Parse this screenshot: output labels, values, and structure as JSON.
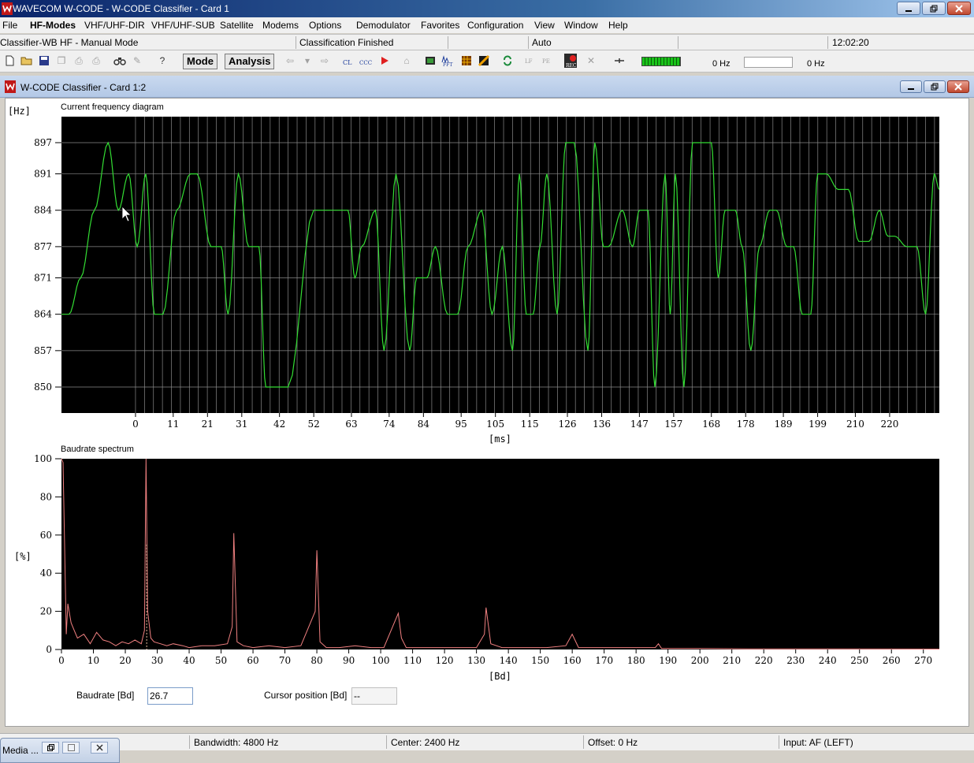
{
  "app": {
    "title": "WAVECOM W-CODE - W-CODE Classifier  - Card 1"
  },
  "menu": [
    "File",
    "HF-Modes",
    "VHF/UHF-DIR",
    "VHF/UHF-SUB",
    "Satellite",
    "Modems",
    "Options",
    "Demodulator",
    "Favorites",
    "Configuration",
    "View",
    "Window",
    "Help"
  ],
  "status_top": {
    "mode": "Classifier-WB HF - Manual Mode",
    "state": "Classification Finished",
    "auto": "Auto",
    "time": "12:02:20"
  },
  "toolbar": {
    "mode_label": "Mode",
    "analysis_label": "Analysis",
    "freq_left": "0 Hz",
    "freq_right": "0 Hz"
  },
  "child_window": {
    "title": "W-CODE Classifier  - Card 1:2"
  },
  "frequency_panel": {
    "title": "Current frequency diagram",
    "y_unit": "[Hz]",
    "x_unit": "[ms]"
  },
  "baud_panel": {
    "title": "Baudrate spectrum",
    "y_unit": "[%]",
    "x_unit": "[Bd]"
  },
  "fields": {
    "baudrate_label": "Baudrate [Bd]",
    "baudrate_value": "26.7",
    "cursor_label": "Cursor position [Bd]",
    "cursor_value": "--"
  },
  "status_bottom": {
    "bandwidth": "Bandwidth: 4800 Hz",
    "center": "Center: 2400 Hz",
    "offset": "Offset: 0 Hz",
    "input": "Input: AF (LEFT)"
  },
  "taskbar": {
    "media_title": "Media ..."
  },
  "colors": {
    "freq_trace": "#33dd33",
    "baud_trace": "#f08080",
    "plot_bg": "#000000",
    "grid": "#8a8a8a"
  },
  "chart_data": [
    {
      "type": "line",
      "title": "Current frequency diagram",
      "ylabel": "[Hz]",
      "xlabel": "[ms]",
      "y_ticks": [
        897,
        891,
        884,
        877,
        871,
        864,
        857,
        850
      ],
      "x_ticks": [
        0,
        11,
        21,
        31,
        42,
        52,
        63,
        74,
        84,
        95,
        105,
        115,
        126,
        136,
        147,
        157,
        168,
        178,
        189,
        199,
        210,
        220
      ],
      "ylim": [
        845,
        902
      ],
      "xlim": [
        -21.6,
        234.5
      ],
      "grid": true,
      "x": [
        -21.6,
        -19.4,
        -16.0,
        -12.0,
        -8.0,
        -5.0,
        -2.0,
        0.5,
        3.0,
        5.5,
        8.0,
        12.0,
        16.0,
        18.0,
        22.0,
        25.0,
        27.0,
        30.0,
        33.0,
        36.0,
        38.0,
        42.0,
        44.5,
        52.0,
        54.5,
        62.0,
        64.0,
        66.0,
        70.0,
        72.5,
        76.0,
        80.0,
        82.0,
        85.0,
        87.5,
        91.0,
        94.0,
        97.0,
        101.0,
        104.0,
        107.0,
        110.0,
        112.0,
        114.0,
        116.0,
        118.0,
        120.0,
        123.0,
        125.5,
        128.0,
        132.0,
        134.0,
        136.5,
        138.0,
        142.0,
        145.0,
        147.0,
        149.5,
        151.5,
        154.5,
        156.0,
        157.5,
        160.0,
        162.5,
        165.0,
        168.0,
        170.0,
        172.0,
        175.0,
        177.0,
        179.5,
        182.0,
        185.0,
        187.0,
        190.0,
        192.0,
        194.5,
        197.0,
        199.0,
        201.5,
        205.0,
        208.0,
        211.0,
        214.0,
        217.0,
        219.5,
        221.5,
        225.0,
        228.0,
        230.5,
        233.0,
        234.5
      ],
      "y": [
        864,
        864,
        871,
        884,
        897,
        884,
        891,
        877,
        891,
        864,
        864,
        884,
        891,
        891,
        877,
        877,
        864,
        891,
        877,
        877,
        850,
        850,
        850,
        884,
        884,
        884,
        871,
        877,
        884,
        857,
        891,
        857,
        871,
        871,
        877,
        864,
        864,
        877,
        884,
        864,
        877,
        857,
        891,
        864,
        864,
        877,
        891,
        864,
        897,
        897,
        857,
        897,
        877,
        877,
        884,
        877,
        884,
        884,
        850,
        891,
        864,
        891,
        850,
        897,
        897,
        897,
        871,
        884,
        884,
        877,
        857,
        877,
        884,
        884,
        877,
        877,
        864,
        864,
        891,
        891,
        888,
        888,
        878,
        878,
        884,
        879,
        879,
        877,
        877,
        864,
        891,
        888
      ]
    },
    {
      "type": "line",
      "title": "Baudrate spectrum",
      "ylabel": "[%]",
      "xlabel": "[Bd]",
      "y_ticks": [
        0,
        20,
        40,
        60,
        80,
        100
      ],
      "x_ticks": [
        0,
        10,
        20,
        30,
        40,
        50,
        60,
        70,
        80,
        90,
        100,
        110,
        120,
        130,
        140,
        150,
        160,
        170,
        180,
        190,
        200,
        210,
        220,
        230,
        240,
        250,
        260,
        270
      ],
      "ylim": [
        0,
        100
      ],
      "xlim": [
        0,
        275
      ],
      "grid": false,
      "x": [
        0,
        0.5,
        1.5,
        2.0,
        3.0,
        4.0,
        5.0,
        7.0,
        9.0,
        11.0,
        13.0,
        15.0,
        17.0,
        19.0,
        21.0,
        23.0,
        25.0,
        26.0,
        26.5,
        27.0,
        28.0,
        29.0,
        31.0,
        33.0,
        35.0,
        38.0,
        40.0,
        44.0,
        48.0,
        52.0,
        53.5,
        54.0,
        55.0,
        57.0,
        60.0,
        65.0,
        70.0,
        75.0,
        79.5,
        80.0,
        81.0,
        83.0,
        87.0,
        92.0,
        97.0,
        101.0,
        105.5,
        106.5,
        108.0,
        112.0,
        118.0,
        124.0,
        130.0,
        132.5,
        133.0,
        134.5,
        138.0,
        145.0,
        152.0,
        158.0,
        160.0,
        162.0,
        168.0,
        176.0,
        186.0,
        187.0,
        188.0,
        200.0,
        215.0,
        240.0,
        275.0
      ],
      "y": [
        100,
        98,
        8,
        24,
        14,
        10,
        6,
        8,
        3,
        9,
        5,
        4,
        2,
        4,
        3,
        5,
        3,
        10,
        100,
        20,
        6,
        4,
        3,
        2,
        3,
        2,
        1,
        2,
        2,
        3,
        12,
        61,
        4,
        2,
        1,
        2,
        1,
        2,
        20,
        52,
        4,
        1,
        1,
        2,
        1,
        1,
        19,
        6,
        1,
        1,
        1,
        1,
        1,
        8,
        22,
        3,
        1,
        1,
        1,
        2,
        8,
        1,
        1,
        1,
        1,
        3,
        0.5,
        0.5,
        0.3,
        0.3,
        0.2
      ]
    }
  ]
}
